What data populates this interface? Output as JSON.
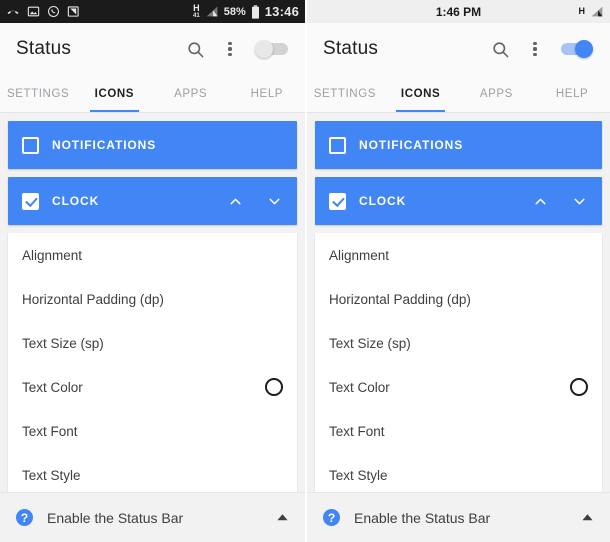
{
  "panels": [
    {
      "statusbar": {
        "theme": "dark",
        "notification_icons": [
          "missed-call-icon",
          "screenshot-icon",
          "whatsapp-icon",
          "folder-icon"
        ],
        "network": "H",
        "network_sub": "41",
        "battery_percent": "58%",
        "clock": "13:46"
      },
      "appbar": {
        "title": "Status",
        "search_icon": "search-icon",
        "overflow_icon": "more-vert-icon",
        "toggle_state": "off"
      },
      "tabs": [
        {
          "label": "SETTINGS",
          "active": false
        },
        {
          "label": "ICONS",
          "active": true
        },
        {
          "label": "APPS",
          "active": false
        },
        {
          "label": "HELP",
          "active": false
        }
      ],
      "groups": [
        {
          "label": "NOTIFICATIONS",
          "checked": false,
          "expanded": false
        },
        {
          "label": "CLOCK",
          "checked": true,
          "expanded": true
        }
      ],
      "rows": [
        {
          "label": "Alignment",
          "swatch": false
        },
        {
          "label": "Horizontal Padding (dp)",
          "swatch": false
        },
        {
          "label": "Text Size (sp)",
          "swatch": false
        },
        {
          "label": "Text Color",
          "swatch": true
        },
        {
          "label": "Text Font",
          "swatch": false
        },
        {
          "label": "Text Style",
          "swatch": false
        }
      ],
      "bottombar": {
        "help_icon": "help-circle-icon",
        "label": "Enable the Status Bar",
        "caret_icon": "caret-up-icon"
      }
    },
    {
      "statusbar": {
        "theme": "light",
        "notification_icons": [],
        "network": "H",
        "network_sub": "",
        "battery_percent": "",
        "clock": "1:46 PM"
      },
      "appbar": {
        "title": "Status",
        "search_icon": "search-icon",
        "overflow_icon": "more-vert-icon",
        "toggle_state": "on"
      },
      "tabs": [
        {
          "label": "SETTINGS",
          "active": false
        },
        {
          "label": "ICONS",
          "active": true
        },
        {
          "label": "APPS",
          "active": false
        },
        {
          "label": "HELP",
          "active": false
        }
      ],
      "groups": [
        {
          "label": "NOTIFICATIONS",
          "checked": false,
          "expanded": false
        },
        {
          "label": "CLOCK",
          "checked": true,
          "expanded": true
        }
      ],
      "rows": [
        {
          "label": "Alignment",
          "swatch": false
        },
        {
          "label": "Horizontal Padding (dp)",
          "swatch": false
        },
        {
          "label": "Text Size (sp)",
          "swatch": false
        },
        {
          "label": "Text Color",
          "swatch": true
        },
        {
          "label": "Text Font",
          "swatch": false
        },
        {
          "label": "Text Style",
          "swatch": false
        }
      ],
      "bottombar": {
        "help_icon": "help-circle-icon",
        "label": "Enable the Status Bar",
        "caret_icon": "caret-up-icon"
      }
    }
  ],
  "colors": {
    "accent": "#4285f4",
    "accent_track": "#a7c3f5",
    "statusbar_dark": "#1b1b1b",
    "statusbar_light": "#efefef",
    "page_bg": "#f2f2f2",
    "card_bg": "#ffffff",
    "text_primary": "#3c4043",
    "text_muted": "#9aa0a6"
  }
}
